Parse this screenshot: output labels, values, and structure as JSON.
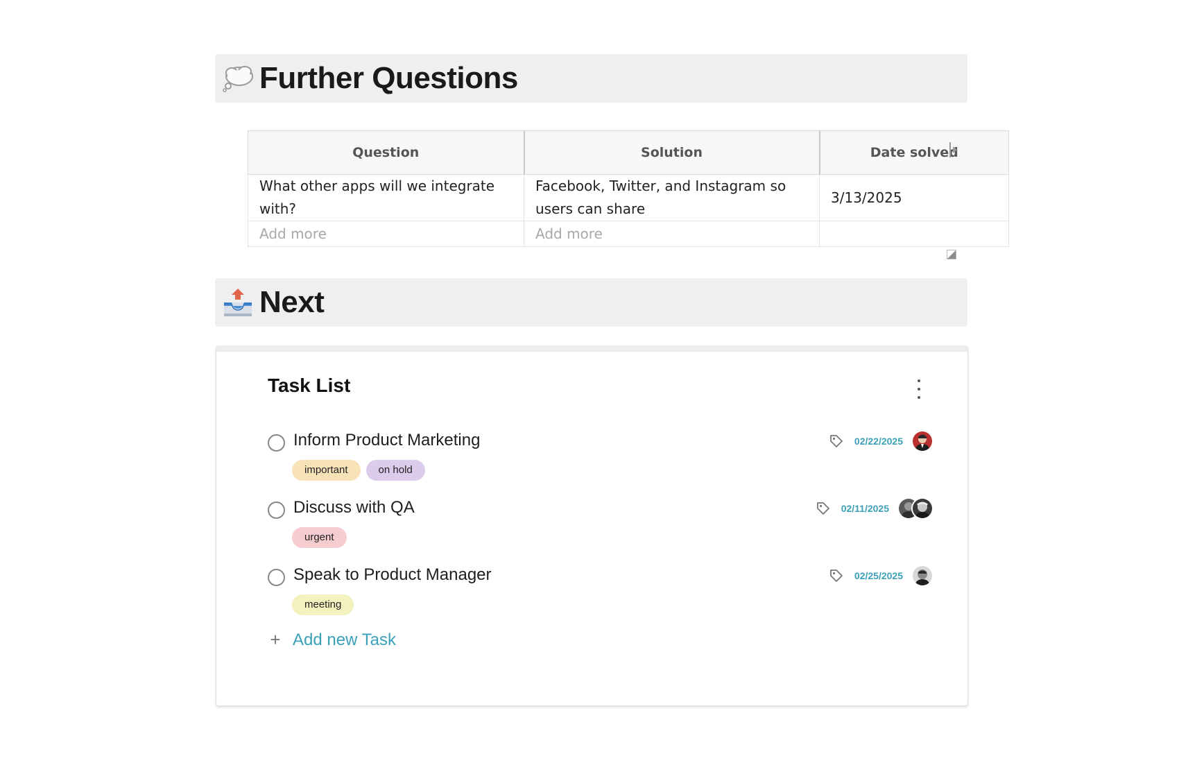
{
  "sections": {
    "further_questions": {
      "emoji": "thought-bubble-icon",
      "title": "Further Questions"
    },
    "next": {
      "emoji": "outbox-tray-icon",
      "title": "Next"
    }
  },
  "questions_table": {
    "headers": [
      "Question",
      "Solution",
      "Date solved"
    ],
    "rows": [
      {
        "question": "What other apps will we integrate with?",
        "solution": "Facebook, Twitter, and Instagram so users can share",
        "date_solved": "3/13/2025"
      }
    ],
    "add_more_placeholder": "Add more"
  },
  "task_list": {
    "title": "Task List",
    "menu_icon": "kebab-menu-icon",
    "tasks": [
      {
        "name": "Inform Product Marketing",
        "date": "02/22/2025",
        "tags": [
          {
            "label": "important",
            "color": "#f8e2b8"
          },
          {
            "label": "on hold",
            "color": "#dccbeb"
          }
        ]
      },
      {
        "name": "Discuss with QA",
        "date": "02/11/2025",
        "tags": [
          {
            "label": "urgent",
            "color": "#f7ccd1"
          }
        ]
      },
      {
        "name": "Speak to Product Manager",
        "date": "02/25/2025",
        "tags": [
          {
            "label": "meeting",
            "color": "#f3f1be"
          }
        ]
      }
    ],
    "add_task_label": "Add new Task",
    "date_color": "#3ba0b8",
    "header_bg": "#efefef"
  }
}
